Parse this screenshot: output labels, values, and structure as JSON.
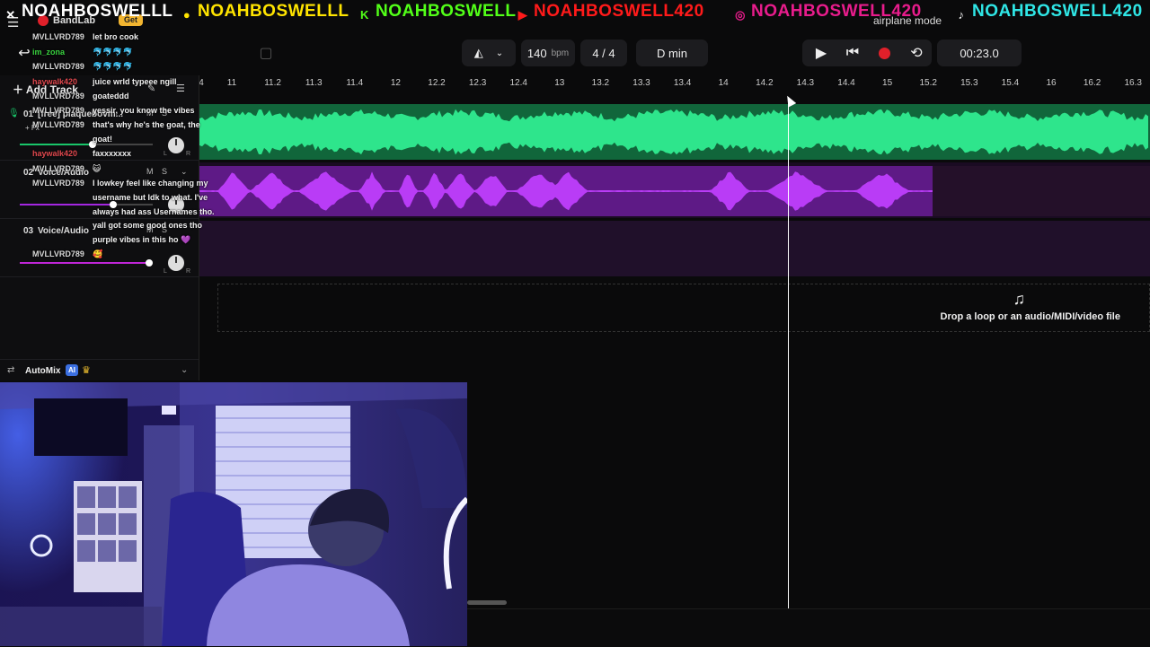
{
  "banner": {
    "segments": [
      {
        "icon": "x",
        "text": "NOAHBOSWELLL",
        "color": "#ffffff",
        "icon_color": "#ffffff"
      },
      {
        "icon": "snapchat",
        "text": "NOAHBOSWELLL",
        "color": "#ffe400",
        "icon_color": "#ffe400"
      },
      {
        "icon": "kick",
        "text": "NOAHBOSWELL",
        "color": "#52ff18",
        "icon_color": "#52ff18"
      },
      {
        "icon": "youtube",
        "text": "NOAHBOSWELL420",
        "color": "#ff1a1a",
        "icon_color": "#ff1a1a"
      },
      {
        "icon": "instagram",
        "text": "NOAHBOSWELL420",
        "color": "#e81c8c",
        "icon_color": "#e81c8c"
      },
      {
        "icon": "tiktok",
        "text": "NOAHBOSWELL420",
        "color": "#2fe6e6",
        "icon_color": "#ffffff"
      }
    ],
    "airplane_mode": "airplane mode"
  },
  "app": {
    "name": "BandLab",
    "get_label": "Get"
  },
  "transport": {
    "bpm_value": "140",
    "bpm_unit": "bpm",
    "time_signature": "4 / 4",
    "key": "D min",
    "time": "00:23.0",
    "record_color": "#e0202a"
  },
  "left_panel": {
    "add_track": "Add Track",
    "tracks": [
      {
        "num": "01",
        "name": "[free] plaquebovm...",
        "color": "#19c66a",
        "volume": 0.55
      },
      {
        "num": "02",
        "name": "Voice/Audio",
        "color": "#a326e0",
        "volume": 0.7
      },
      {
        "num": "03",
        "name": "Voice/Audio",
        "color": "#c025d8",
        "volume": 0.97
      }
    ],
    "fx_label": "+ Fx",
    "mute_label": "M",
    "solo_label": "S",
    "left_label": "L",
    "right_label": "R",
    "automix_label": "AutoMix",
    "ai_badge": "AI"
  },
  "ruler": {
    "labels": [
      "4",
      "11",
      "11.2",
      "11.3",
      "11.4",
      "12",
      "12.2",
      "12.3",
      "12.4",
      "13",
      "13.2",
      "13.3",
      "13.4",
      "14",
      "14.2",
      "14.3",
      "14.4",
      "15",
      "15.2",
      "15.3",
      "15.4",
      "16",
      "16.2",
      "16.3"
    ]
  },
  "dropzone": {
    "text": "Drop a loop or an audio/MIDI/video file"
  },
  "chat": [
    {
      "user": "MVLLVRD789",
      "user_color": "#d8d8d8",
      "text": "let bro cook"
    },
    {
      "user": "im_zona",
      "user_color": "#39d23f",
      "text": "🐬🐬🐬🐬"
    },
    {
      "user": "MVLLVRD789",
      "user_color": "#d8d8d8",
      "text": "🐬🐬🐬🐬"
    },
    {
      "user": "haywalk420",
      "user_color": "#e0484e",
      "text": "juice wrld typeee ngill"
    },
    {
      "user": "MVLLVRD789",
      "user_color": "#d8d8d8",
      "text": "goateddd"
    },
    {
      "user": "MVLLVRD789",
      "user_color": "#d8d8d8",
      "text": "yessir, you know the vibes"
    },
    {
      "user": "MVLLVRD789",
      "user_color": "#d8d8d8",
      "text": "that's why he's the goat, the"
    },
    {
      "user": "",
      "user_color": "#d8d8d8",
      "text": "goat!"
    },
    {
      "user": "haywalk420",
      "user_color": "#e0484e",
      "text": "faxxxxxxx"
    },
    {
      "user": "MVLLVRD789",
      "user_color": "#d8d8d8",
      "text": "😺"
    },
    {
      "user": "MVLLVRD789",
      "user_color": "#d8d8d8",
      "text": "I lowkey feel like changing my"
    },
    {
      "user": "",
      "user_color": "#d8d8d8",
      "text": "username but Idk to what. I've"
    },
    {
      "user": "",
      "user_color": "#d8d8d8",
      "text": "always had ass Usernames tho."
    },
    {
      "user": "",
      "user_color": "#d8d8d8",
      "text": "yall got some good ones tho"
    },
    {
      "user": "",
      "user_color": "#d8d8d8",
      "text": "purple vibes in this ho 💜"
    },
    {
      "user": "MVLLVRD789",
      "user_color": "#d8d8d8",
      "text": "🥰"
    }
  ]
}
